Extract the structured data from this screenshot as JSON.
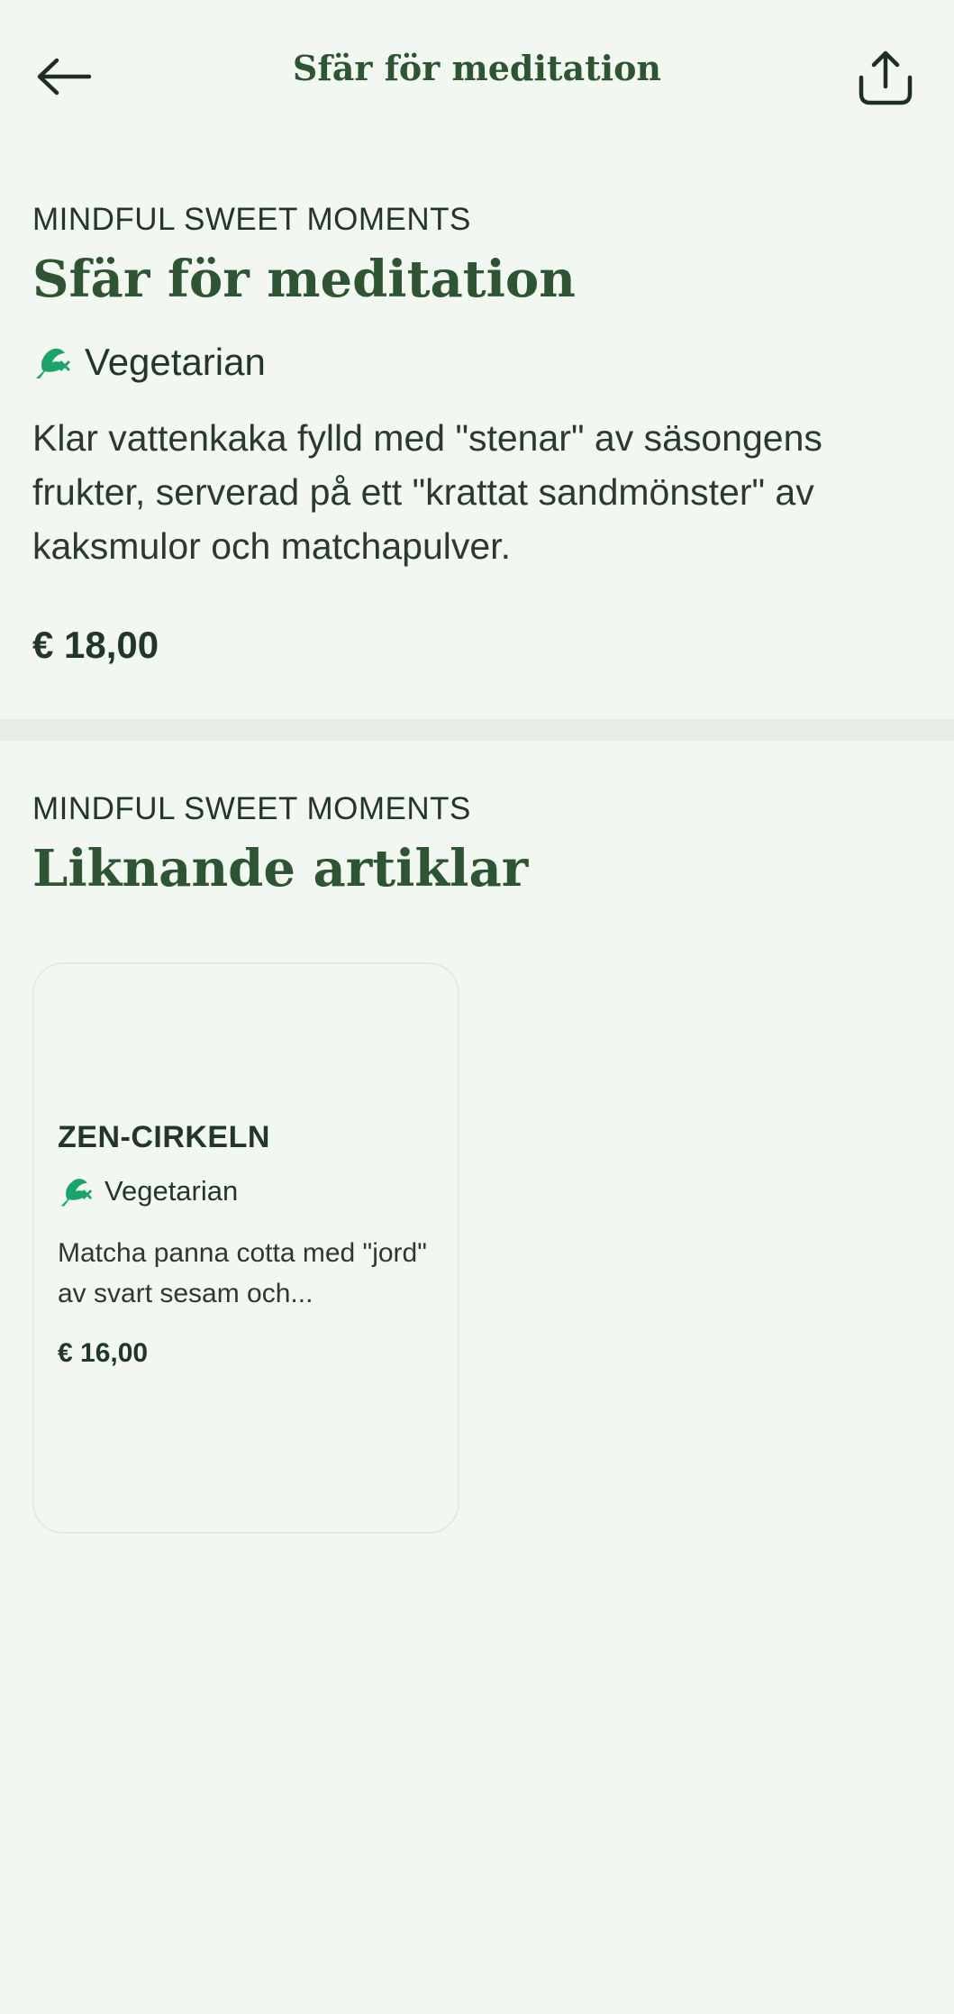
{
  "header": {
    "title": "Sfär för meditation",
    "back_icon": "arrow-left-icon",
    "share_icon": "share-icon"
  },
  "product": {
    "category": "MINDFUL SWEET MOMENTS",
    "title": "Sfär för meditation",
    "diet": "Vegetarian",
    "description": "Klar vattenkaka fylld med \"stenar\" av säsongens frukter, serverad på ett \"krattat sandmönster\" av kaksmulor och matchapulver.",
    "price": "€ 18,00"
  },
  "similar": {
    "category": "MINDFUL SWEET MOMENTS",
    "title": "Liknande artiklar",
    "items": [
      {
        "title": "ZEN-CIRKELN",
        "diet": "Vegetarian",
        "description": "Matcha panna cotta med \"jord\" av svart sesam och...",
        "price": "€ 16,00"
      }
    ]
  },
  "colors": {
    "background": "#f3f7f1",
    "heading_green": "#2e5533",
    "text_dark": "#22372a",
    "diet_icon_green": "#1aa36b",
    "divider": "#e7ece6"
  }
}
